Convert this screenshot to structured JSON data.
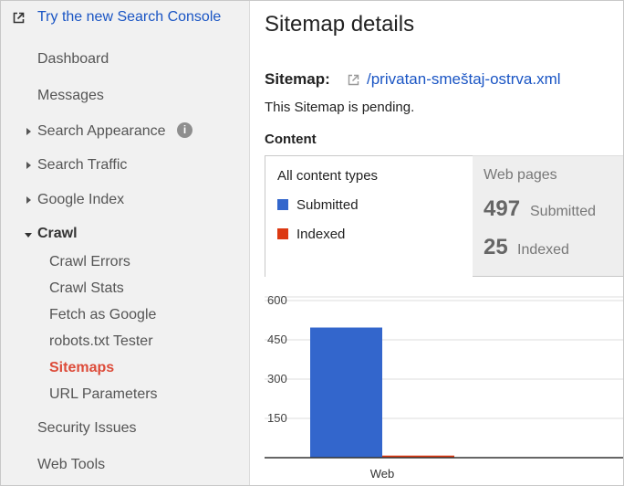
{
  "sidebar": {
    "promo": "Try the new Search Console",
    "items": [
      {
        "label": "Dashboard"
      },
      {
        "label": "Messages"
      },
      {
        "label": "Search Appearance"
      },
      {
        "label": "Search Traffic"
      },
      {
        "label": "Google Index"
      },
      {
        "label": "Crawl"
      },
      {
        "label": "Crawl Errors"
      },
      {
        "label": "Crawl Stats"
      },
      {
        "label": "Fetch as Google"
      },
      {
        "label": "robots.txt Tester"
      },
      {
        "label": "Sitemaps"
      },
      {
        "label": "URL Parameters"
      },
      {
        "label": "Security Issues"
      },
      {
        "label": "Web Tools"
      }
    ],
    "info_glyph": "i"
  },
  "main": {
    "title": "Sitemap details",
    "sitemap_label": "Sitemap:",
    "sitemap_url": "/privatan-smeštaj-ostrva.xml",
    "pending_text": "This Sitemap is pending.",
    "content_heading": "Content",
    "all_types_label": "All content types",
    "legend_submitted": "Submitted",
    "legend_indexed": "Indexed",
    "web_pages_label": "Web pages",
    "submitted_count": "497",
    "submitted_label": "Submitted",
    "indexed_count": "25",
    "indexed_label": "Indexed"
  },
  "colors": {
    "submitted": "#3366cc",
    "indexed": "#dc3912",
    "link": "#1a55c4",
    "active": "#dd4b39"
  },
  "chart_data": {
    "type": "bar",
    "categories": [
      "Web"
    ],
    "series": [
      {
        "name": "Submitted",
        "values": [
          497
        ]
      },
      {
        "name": "Indexed",
        "values": [
          8
        ]
      }
    ],
    "yticks": [
      "600",
      "450",
      "300",
      "150"
    ],
    "ylim": [
      0,
      600
    ],
    "grid": true,
    "title": "",
    "xlabel": "",
    "ylabel": ""
  }
}
